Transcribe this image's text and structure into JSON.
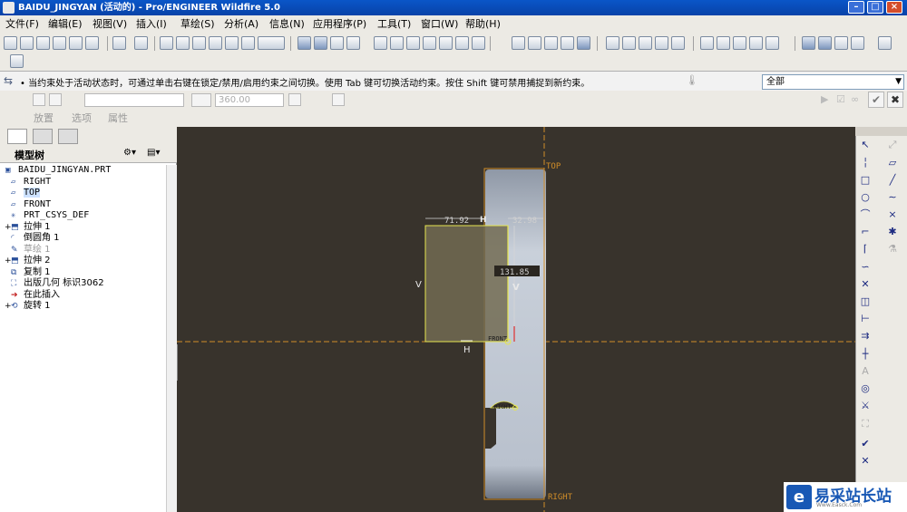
{
  "window": {
    "title": "BAIDU_JINGYAN (活动的) - Pro/ENGINEER Wildfire 5.0",
    "min": "–",
    "max": "□",
    "close": "×"
  },
  "menu": [
    "文件(F)",
    "编辑(E)",
    "视图(V)",
    "插入(I)",
    "草绘(S)",
    "分析(A)",
    "信息(N)",
    "应用程序(P)",
    "工具(T)",
    "窗口(W)",
    "帮助(H)"
  ],
  "status": {
    "message": "• 当约束处于活动状态时，可通过单击右键在锁定/禁用/启用约束之间切换。使用 Tab 键可切换活动约束。按住 Shift 键可禁用捕捉到新约束。",
    "filter_value": "全部"
  },
  "dashboard": {
    "angle_value": "360.00",
    "tabs": [
      "放置",
      "选项",
      "属性"
    ]
  },
  "model_tree": {
    "title": "模型树",
    "items": [
      {
        "label": "BAIDU_JINGYAN.PRT",
        "icon": "part-icon",
        "indent": 0,
        "mono": true
      },
      {
        "label": "RIGHT",
        "icon": "datum-plane-icon",
        "indent": 1,
        "mono": true
      },
      {
        "label": "TOP",
        "icon": "datum-plane-icon",
        "indent": 1,
        "mono": true,
        "selected": true
      },
      {
        "label": "FRONT",
        "icon": "datum-plane-icon",
        "indent": 1,
        "mono": true
      },
      {
        "label": "PRT_CSYS_DEF",
        "icon": "csys-icon",
        "indent": 1,
        "mono": true
      },
      {
        "label": "拉伸 1",
        "icon": "extrude-icon",
        "indent": 1,
        "expand": true
      },
      {
        "label": "倒圆角 1",
        "icon": "round-icon",
        "indent": 1
      },
      {
        "label": "草绘 1",
        "icon": "sketch-icon",
        "indent": 1,
        "dim": true
      },
      {
        "label": "拉伸 2",
        "icon": "extrude-icon",
        "indent": 1,
        "expand": true
      },
      {
        "label": "复制 1",
        "icon": "copy-icon",
        "indent": 1
      },
      {
        "label": "出版几何 标识3062",
        "icon": "publish-geom-icon",
        "indent": 1
      },
      {
        "label": "在此插入",
        "icon": "insert-here-arrow-icon",
        "indent": 1
      },
      {
        "label": "旋转 1",
        "icon": "revolve-icon",
        "indent": 1,
        "expand": true
      }
    ]
  },
  "viewport": {
    "labels": {
      "top": "TOP",
      "right": "RIGHT",
      "dim_left": "71.92",
      "dim_right": "32.98",
      "dim_height": "131.85",
      "constraint_v": "V",
      "constraint_h": "H",
      "constraint_v2": "V",
      "constraint_h2": "H",
      "right_label_small": "RIGHT",
      "front_small": "FRONT"
    },
    "colors": {
      "background": "#38332c",
      "datum": "#d18d28",
      "sketch": "#e6e64f",
      "part_face": "#c3cad4",
      "highlight": "#e03030"
    }
  },
  "watermark": {
    "logo": "e",
    "text": "易采站长站",
    "url": "Www.Easck.Com"
  }
}
